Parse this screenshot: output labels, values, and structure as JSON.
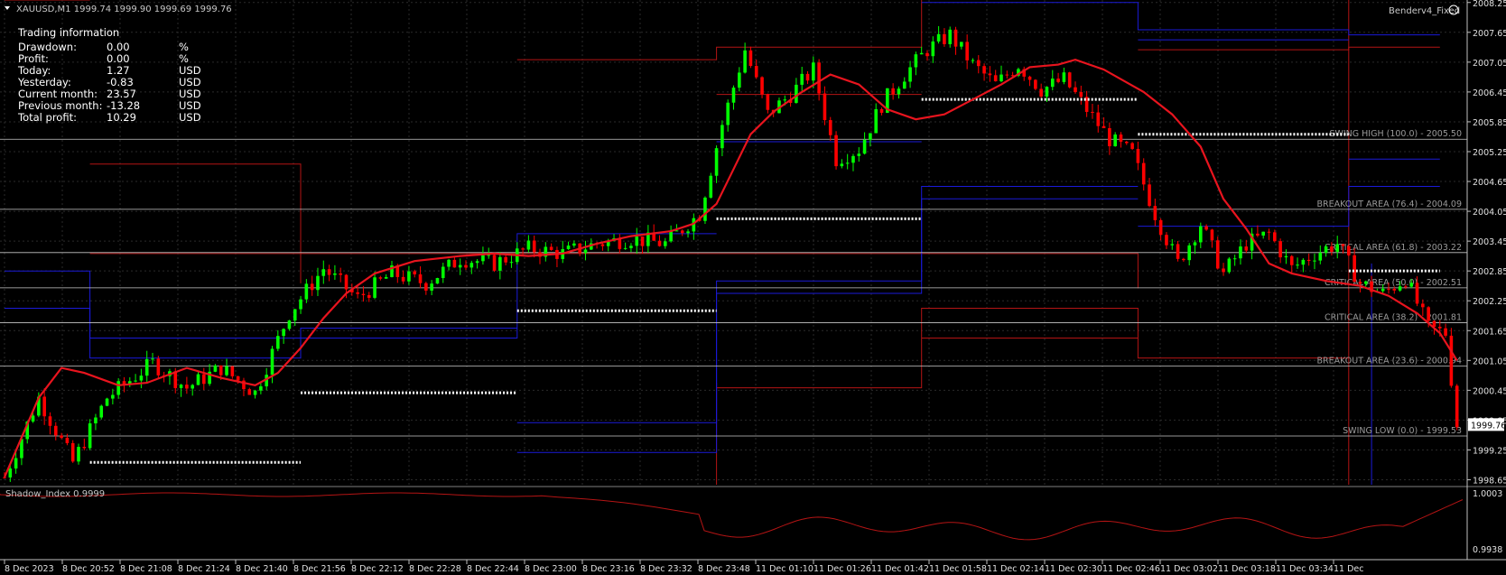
{
  "symbol_header": "XAUUSD,M1  1999.74 1999.90 1999.69 1999.76",
  "expert_label": "Benderv4_Fixed",
  "indicator_label": "Shadow_Index 0.9999",
  "info_panel": {
    "title": "Trading information",
    "rows": [
      {
        "label": "Drawdown:",
        "value": "0.00",
        "unit": "%"
      },
      {
        "label": "Profit:",
        "value": "0.00",
        "unit": "%"
      },
      {
        "label": "Today:",
        "value": "1.27",
        "unit": "USD"
      },
      {
        "label": "Yesterday:",
        "value": "-0.83",
        "unit": "USD"
      },
      {
        "label": "Current month:",
        "value": "23.57",
        "unit": "USD"
      },
      {
        "label": "Previous month:",
        "value": "-13.28",
        "unit": "USD"
      },
      {
        "label": "Total profit:",
        "value": "10.29",
        "unit": "USD"
      }
    ]
  },
  "colors": {
    "background": "#000000",
    "bull": "#00ff00",
    "bear": "#ff0000",
    "ma": "#e8141e",
    "grid": "#2a2a2a",
    "level_red": "#b41414",
    "level_blue": "#1a1ad8",
    "fib": "#c8c8c8",
    "dotted": "#ffffff"
  },
  "chart_data": {
    "type": "candlestick",
    "price_axis_ticks": [
      "2008.25",
      "2007.65",
      "2007.05",
      "2006.45",
      "2005.85",
      "2005.25",
      "2004.65",
      "2004.05",
      "2003.45",
      "2002.85",
      "2002.25",
      "2001.65",
      "2001.05",
      "2000.45",
      "1999.85",
      "1999.25",
      "1998.65"
    ],
    "ylim": [
      1998.55,
      2008.3
    ],
    "current_price": "1999.76",
    "time_axis_ticks": [
      "8 Dec 2023",
      "8 Dec 20:52",
      "8 Dec 21:08",
      "8 Dec 21:24",
      "8 Dec 21:40",
      "8 Dec 21:56",
      "8 Dec 22:12",
      "8 Dec 22:28",
      "8 Dec 22:44",
      "8 Dec 23:00",
      "8 Dec 23:16",
      "8 Dec 23:32",
      "8 Dec 23:48",
      "11 Dec 01:10",
      "11 Dec 01:26",
      "11 Dec 01:42",
      "11 Dec 01:58",
      "11 Dec 02:14",
      "11 Dec 02:30",
      "11 Dec 02:46",
      "11 Dec 03:02",
      "11 Dec 03:18",
      "11 Dec 03:34",
      "11 Dec"
    ],
    "fib_levels": [
      {
        "label": "SWING HIGH (100.0) - 2005.50",
        "price": 2005.5
      },
      {
        "label": "BREAKOUT AREA (76.4) - 2004.09",
        "price": 2004.09
      },
      {
        "label": "CRITICAL AREA (61.8) - 2003.22",
        "price": 2003.22
      },
      {
        "label": "CRITICAL AREA (50.0) - 2002.51",
        "price": 2002.51
      },
      {
        "label": "CRITICAL AREA (38.2) - 2001.81",
        "price": 2001.81
      },
      {
        "label": "BREAKOUT AREA (23.6) - 2000.94",
        "price": 2000.94
      },
      {
        "label": "SWING LOW (0.0) - 1999.53",
        "price": 1999.53
      }
    ],
    "ma_path": [
      [
        0,
        1998.7
      ],
      [
        3,
        1999.5
      ],
      [
        6,
        2000.3
      ],
      [
        10,
        2000.9
      ],
      [
        14,
        2000.8
      ],
      [
        20,
        2000.55
      ],
      [
        25,
        2000.6
      ],
      [
        32,
        2000.9
      ],
      [
        38,
        2000.7
      ],
      [
        44,
        2000.55
      ],
      [
        48,
        2000.8
      ],
      [
        52,
        2001.3
      ],
      [
        56,
        2001.9
      ],
      [
        60,
        2002.4
      ],
      [
        65,
        2002.8
      ],
      [
        72,
        2003.05
      ],
      [
        80,
        2003.15
      ],
      [
        86,
        2003.2
      ],
      [
        92,
        2003.15
      ],
      [
        98,
        2003.2
      ],
      [
        104,
        2003.4
      ],
      [
        110,
        2003.55
      ],
      [
        117,
        2003.65
      ],
      [
        121,
        2003.8
      ],
      [
        125,
        2004.2
      ],
      [
        128,
        2004.9
      ],
      [
        131,
        2005.6
      ],
      [
        135,
        2006.05
      ],
      [
        140,
        2006.45
      ],
      [
        145,
        2006.8
      ],
      [
        150,
        2006.6
      ],
      [
        155,
        2006.1
      ],
      [
        160,
        2005.9
      ],
      [
        165,
        2006.0
      ],
      [
        170,
        2006.3
      ],
      [
        175,
        2006.6
      ],
      [
        180,
        2006.95
      ],
      [
        185,
        2007.0
      ],
      [
        188,
        2007.1
      ],
      [
        193,
        2006.9
      ],
      [
        200,
        2006.45
      ],
      [
        205,
        2006.0
      ],
      [
        210,
        2005.35
      ],
      [
        214,
        2004.3
      ],
      [
        218,
        2003.7
      ],
      [
        222,
        2003.0
      ],
      [
        226,
        2002.8
      ],
      [
        232,
        2002.65
      ],
      [
        238,
        2002.55
      ],
      [
        243,
        2002.35
      ],
      [
        248,
        2002.0
      ],
      [
        252,
        2001.6
      ],
      [
        255,
        2001.05
      ]
    ],
    "swing_points": [
      [
        0,
        1998.7
      ],
      [
        6,
        2000.3
      ],
      [
        12,
        1999.0
      ],
      [
        18,
        2000.3
      ],
      [
        26,
        2001.0
      ],
      [
        32,
        2000.5
      ],
      [
        38,
        2000.9
      ],
      [
        44,
        2000.4
      ],
      [
        50,
        2002.0
      ],
      [
        56,
        2002.9
      ],
      [
        62,
        2002.3
      ],
      [
        68,
        2002.8
      ],
      [
        74,
        2002.6
      ],
      [
        80,
        2003.1
      ],
      [
        86,
        2003.0
      ],
      [
        92,
        2003.3
      ],
      [
        98,
        2003.2
      ],
      [
        104,
        2003.4
      ],
      [
        110,
        2003.5
      ],
      [
        116,
        2003.4
      ],
      [
        122,
        2004.0
      ],
      [
        126,
        2005.8
      ],
      [
        130,
        2007.3
      ],
      [
        134,
        2006.0
      ],
      [
        138,
        2006.4
      ],
      [
        142,
        2006.9
      ],
      [
        146,
        2005.1
      ],
      [
        150,
        2005.3
      ],
      [
        154,
        2006.2
      ],
      [
        158,
        2006.8
      ],
      [
        162,
        2007.3
      ],
      [
        166,
        2007.6
      ],
      [
        170,
        2007.0
      ],
      [
        174,
        2006.6
      ],
      [
        178,
        2007.0
      ],
      [
        182,
        2006.5
      ],
      [
        186,
        2006.7
      ],
      [
        190,
        2006.1
      ],
      [
        194,
        2005.5
      ],
      [
        198,
        2005.2
      ],
      [
        202,
        2004.0
      ],
      [
        206,
        2003.0
      ],
      [
        210,
        2003.8
      ],
      [
        214,
        2002.8
      ],
      [
        218,
        2003.4
      ],
      [
        222,
        2003.6
      ],
      [
        226,
        2002.9
      ],
      [
        230,
        2003.2
      ],
      [
        234,
        2003.4
      ],
      [
        238,
        2002.6
      ],
      [
        242,
        2002.4
      ],
      [
        246,
        2002.7
      ],
      [
        250,
        2001.7
      ],
      [
        253,
        2001.6
      ],
      [
        255,
        1999.76
      ]
    ],
    "dotted_levels": [
      {
        "from": 15,
        "to": 52,
        "price": 1999.0
      },
      {
        "from": 52,
        "to": 90,
        "price": 2000.4
      },
      {
        "from": 90,
        "to": 125,
        "price": 2002.05
      },
      {
        "from": 125,
        "to": 161,
        "price": 2003.9
      },
      {
        "from": 161,
        "to": 199,
        "price": 2006.3
      },
      {
        "from": 199,
        "to": 236,
        "price": 2005.6
      },
      {
        "from": 236,
        "to": 252,
        "price": 2002.85
      }
    ],
    "shadow_index_range": [
      "1.0003",
      "0.9938"
    ]
  }
}
